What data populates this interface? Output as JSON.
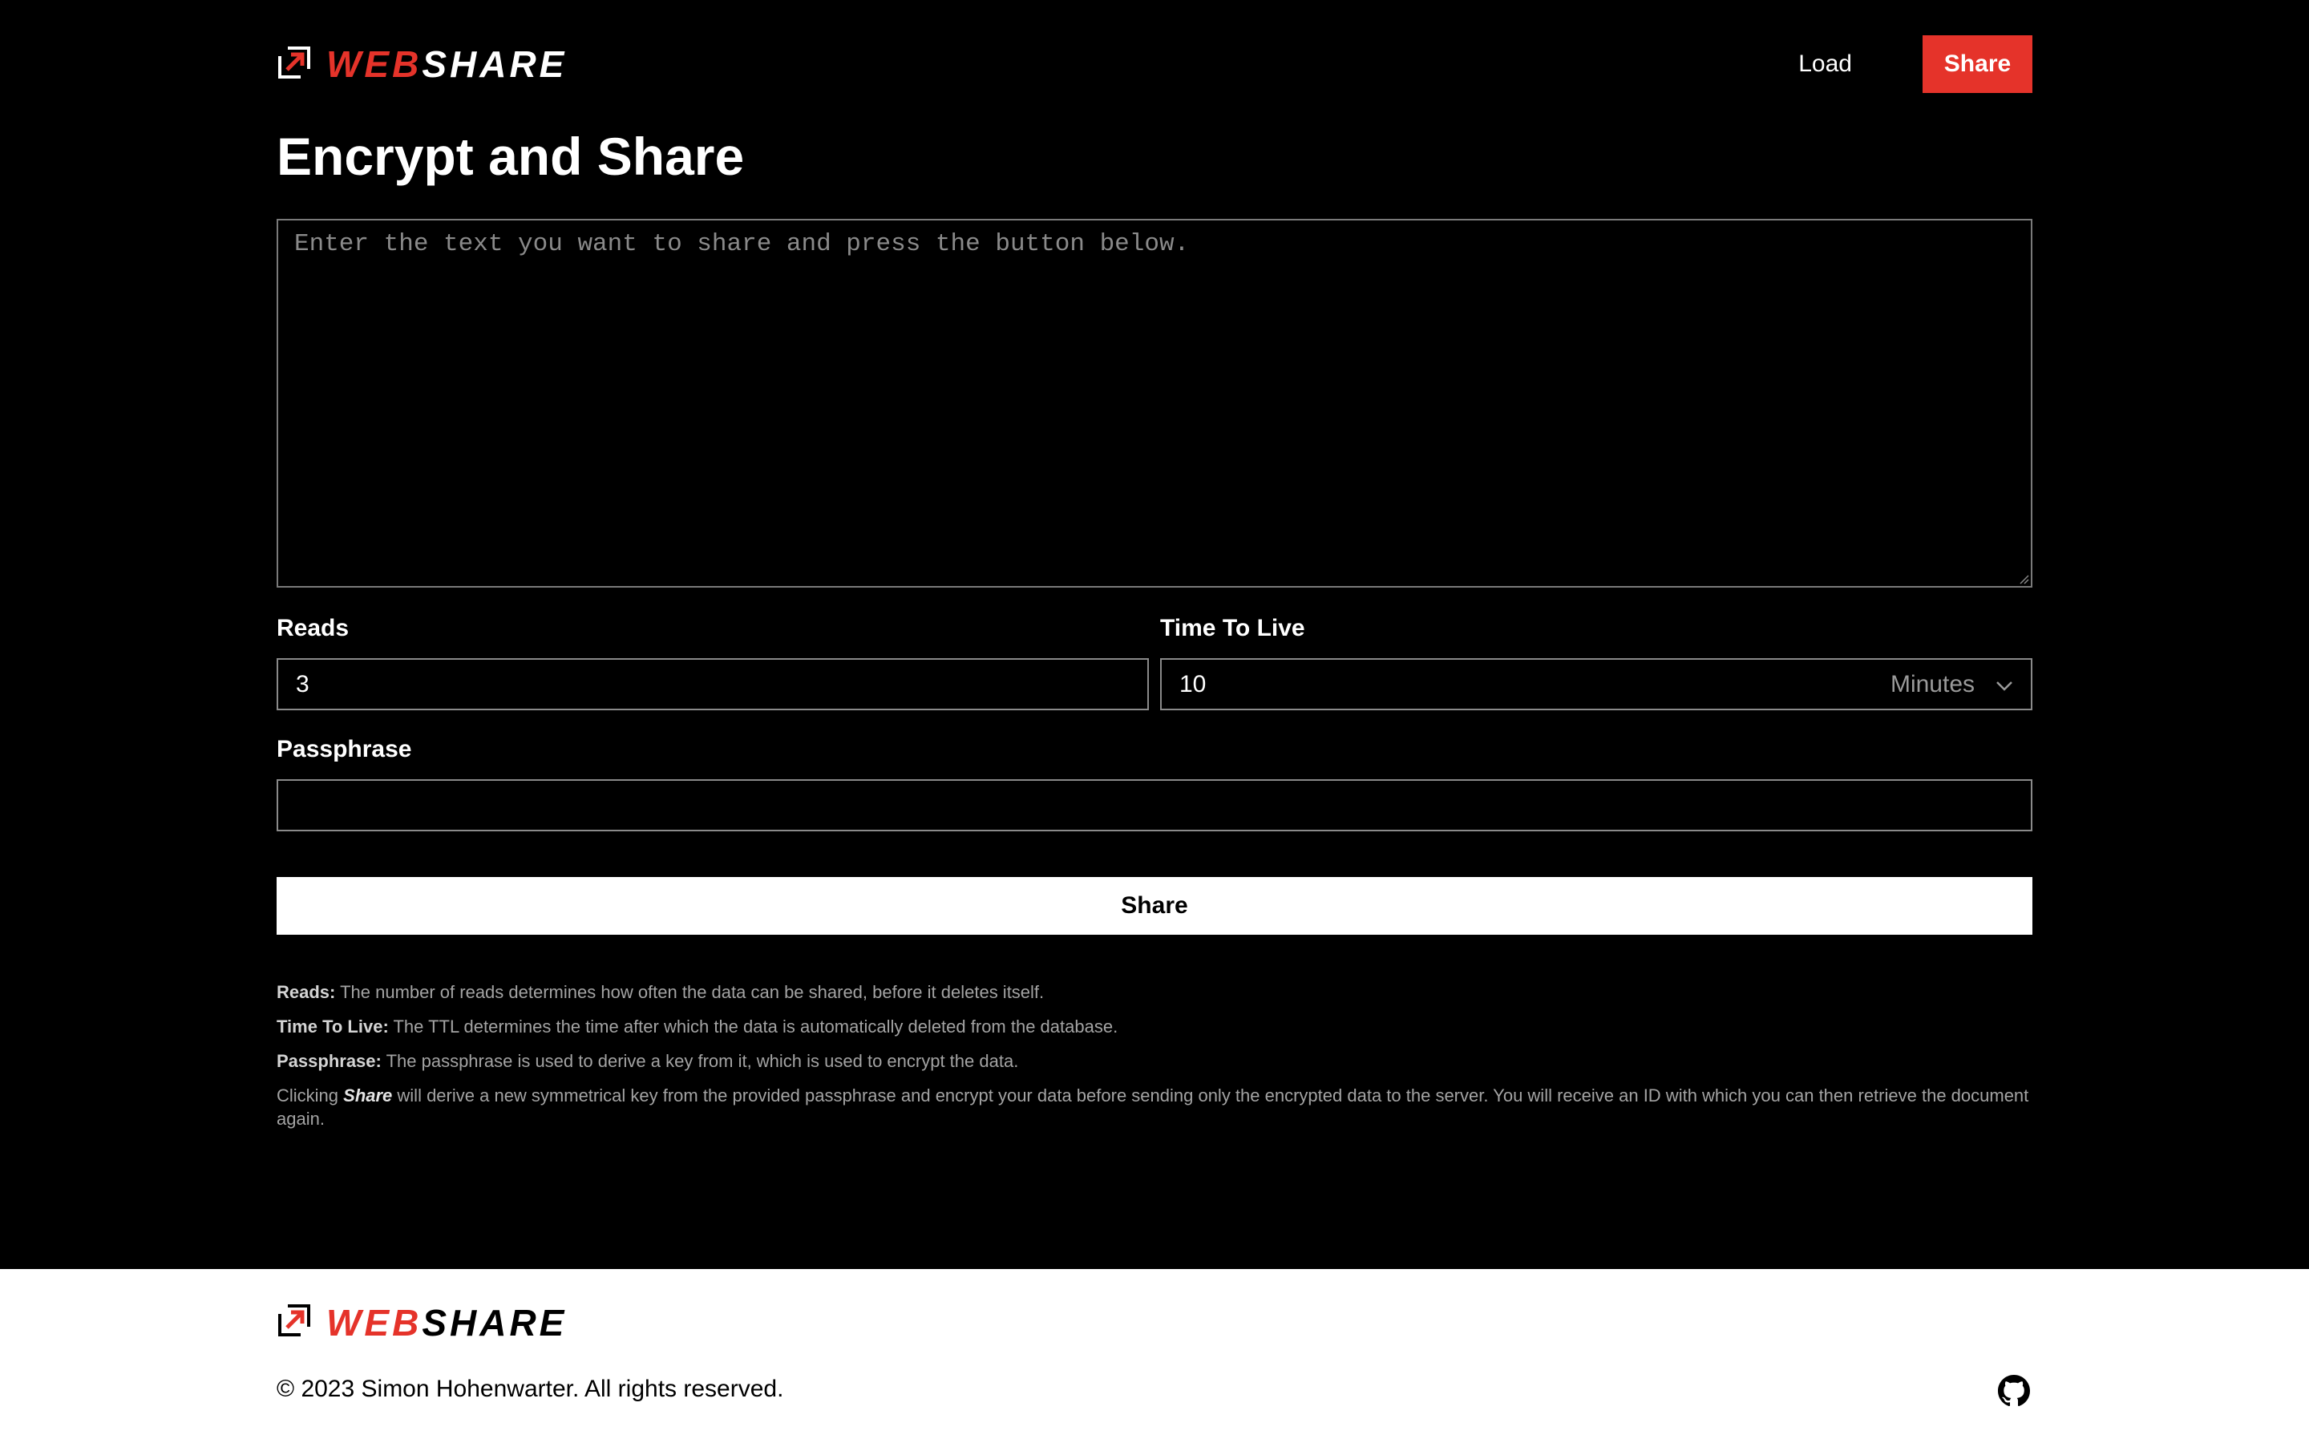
{
  "header": {
    "logo_text_left": "WEB",
    "logo_text_right": "SHARE",
    "nav_load": "Load",
    "nav_share": "Share"
  },
  "page_title": "Encrypt and Share",
  "text_input": {
    "placeholder": "Enter the text you want to share and press the button below.",
    "value": ""
  },
  "reads": {
    "label": "Reads",
    "value": "3"
  },
  "ttl": {
    "label": "Time To Live",
    "value": "10",
    "unit": "Minutes"
  },
  "passphrase": {
    "label": "Passphrase",
    "value": ""
  },
  "share_button": "Share",
  "info": {
    "reads_term": "Reads:",
    "reads_desc": " The number of reads determines how often the data can be shared, before it deletes itself.",
    "ttl_term": "Time To Live:",
    "ttl_desc": " The TTL determines the time after which the data is automatically deleted from the database.",
    "pass_term": "Passphrase:",
    "pass_desc": " The passphrase is used to derive a key from it, which is used to encrypt the data.",
    "click_pre": "Clicking ",
    "click_term": "Share",
    "click_post": " will derive a new symmetrical key from the provided passphrase and encrypt your data before sending only the encrypted data to the server. You will receive an ID with which you can then retrieve the document again."
  },
  "footer": {
    "logo_text_left": "WEB",
    "logo_text_right": "SHARE",
    "copyright": "© 2023 Simon Hohenwarter. All rights reserved."
  },
  "icons": {
    "logo": "share-arrow-box-icon",
    "dropdown": "chevron-down-icon",
    "github": "github-icon"
  },
  "colors": {
    "accent": "#e5332a",
    "background": "#000000",
    "footer_bg": "#ffffff"
  }
}
